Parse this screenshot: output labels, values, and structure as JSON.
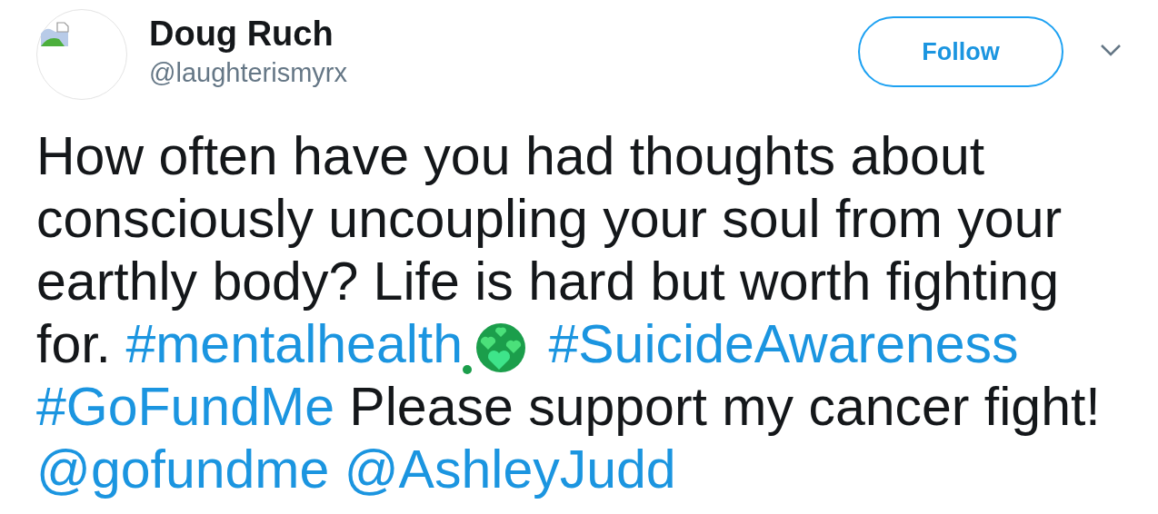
{
  "author": {
    "name": "Doug Ruch",
    "handle": "@laughterismyrx"
  },
  "follow_button": {
    "label": "Follow"
  },
  "tweet": [
    {
      "kind": "text",
      "text": "How often have you had thoughts about consciously uncoupling your soul from your earthly body? Life is hard but worth fighting for. "
    },
    {
      "kind": "link",
      "text": "#mentalhealth"
    },
    {
      "kind": "emoji"
    },
    {
      "kind": "space"
    },
    {
      "kind": "link",
      "text": "#SuicideAwareness"
    },
    {
      "kind": "space"
    },
    {
      "kind": "link",
      "text": "#GoFundMe"
    },
    {
      "kind": "text",
      "text": " Please support my cancer fight! "
    },
    {
      "kind": "link",
      "text": "@gofundme"
    },
    {
      "kind": "space"
    },
    {
      "kind": "link",
      "text": "@AshleyJudd"
    }
  ]
}
